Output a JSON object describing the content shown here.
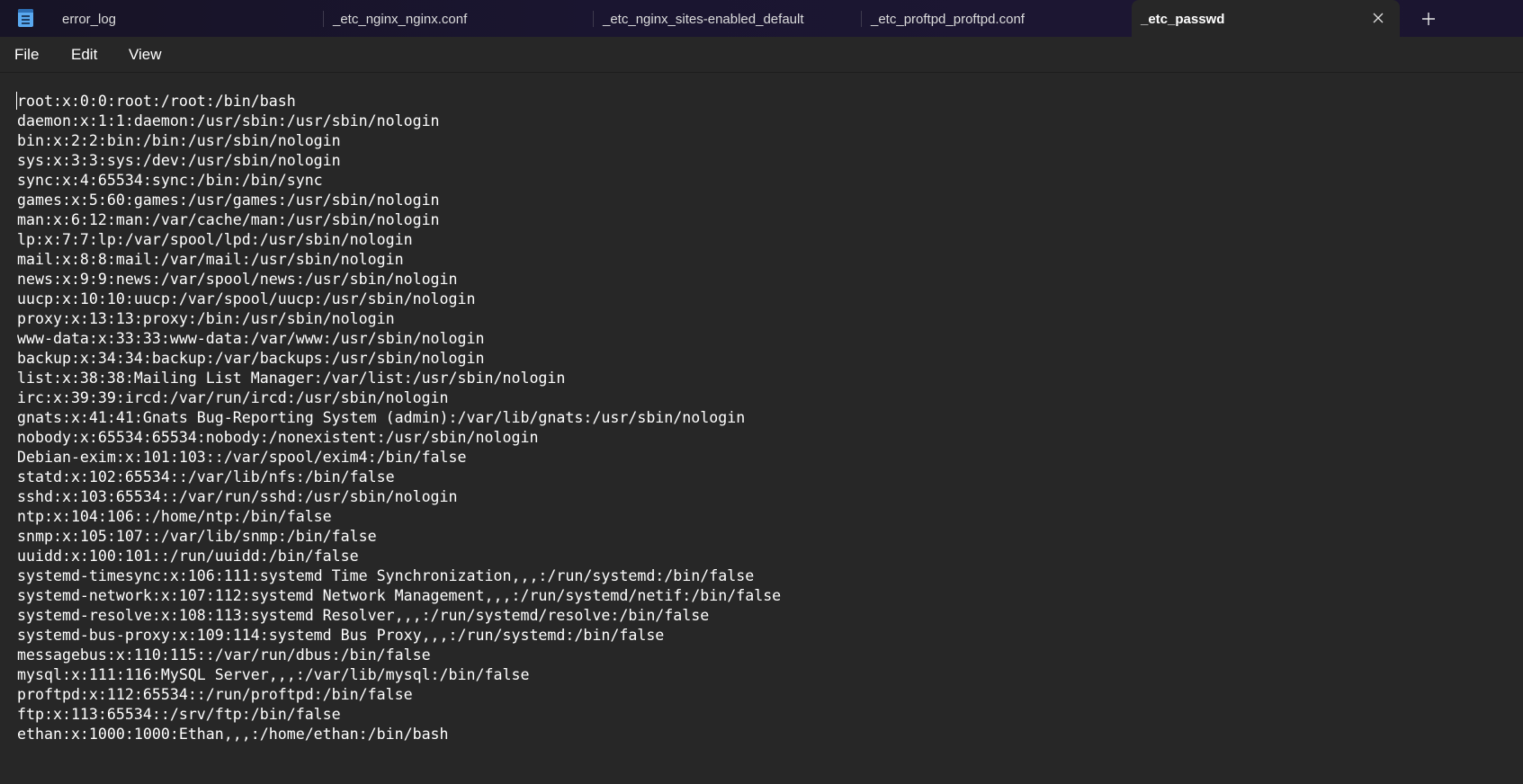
{
  "tabs": [
    {
      "label": "error_log",
      "active": false
    },
    {
      "label": "_etc_nginx_nginx.conf",
      "active": false
    },
    {
      "label": "_etc_nginx_sites-enabled_default",
      "active": false
    },
    {
      "label": "_etc_proftpd_proftpd.conf",
      "active": false
    },
    {
      "label": "_etc_passwd",
      "active": true
    }
  ],
  "menu": {
    "file": "File",
    "edit": "Edit",
    "view": "View"
  },
  "icons": {
    "app": "notepad-icon",
    "close": "close-icon",
    "new_tab": "plus-icon"
  },
  "editor": {
    "lines": [
      "root:x:0:0:root:/root:/bin/bash",
      "daemon:x:1:1:daemon:/usr/sbin:/usr/sbin/nologin",
      "bin:x:2:2:bin:/bin:/usr/sbin/nologin",
      "sys:x:3:3:sys:/dev:/usr/sbin/nologin",
      "sync:x:4:65534:sync:/bin:/bin/sync",
      "games:x:5:60:games:/usr/games:/usr/sbin/nologin",
      "man:x:6:12:man:/var/cache/man:/usr/sbin/nologin",
      "lp:x:7:7:lp:/var/spool/lpd:/usr/sbin/nologin",
      "mail:x:8:8:mail:/var/mail:/usr/sbin/nologin",
      "news:x:9:9:news:/var/spool/news:/usr/sbin/nologin",
      "uucp:x:10:10:uucp:/var/spool/uucp:/usr/sbin/nologin",
      "proxy:x:13:13:proxy:/bin:/usr/sbin/nologin",
      "www-data:x:33:33:www-data:/var/www:/usr/sbin/nologin",
      "backup:x:34:34:backup:/var/backups:/usr/sbin/nologin",
      "list:x:38:38:Mailing List Manager:/var/list:/usr/sbin/nologin",
      "irc:x:39:39:ircd:/var/run/ircd:/usr/sbin/nologin",
      "gnats:x:41:41:Gnats Bug-Reporting System (admin):/var/lib/gnats:/usr/sbin/nologin",
      "nobody:x:65534:65534:nobody:/nonexistent:/usr/sbin/nologin",
      "Debian-exim:x:101:103::/var/spool/exim4:/bin/false",
      "statd:x:102:65534::/var/lib/nfs:/bin/false",
      "sshd:x:103:65534::/var/run/sshd:/usr/sbin/nologin",
      "ntp:x:104:106::/home/ntp:/bin/false",
      "snmp:x:105:107::/var/lib/snmp:/bin/false",
      "uuidd:x:100:101::/run/uuidd:/bin/false",
      "systemd-timesync:x:106:111:systemd Time Synchronization,,,:/run/systemd:/bin/false",
      "systemd-network:x:107:112:systemd Network Management,,,:/run/systemd/netif:/bin/false",
      "systemd-resolve:x:108:113:systemd Resolver,,,:/run/systemd/resolve:/bin/false",
      "systemd-bus-proxy:x:109:114:systemd Bus Proxy,,,:/run/systemd:/bin/false",
      "messagebus:x:110:115::/var/run/dbus:/bin/false",
      "mysql:x:111:116:MySQL Server,,,:/var/lib/mysql:/bin/false",
      "proftpd:x:112:65534::/run/proftpd:/bin/false",
      "ftp:x:113:65534::/srv/ftp:/bin/false",
      "ethan:x:1000:1000:Ethan,,,:/home/ethan:/bin/bash"
    ]
  }
}
